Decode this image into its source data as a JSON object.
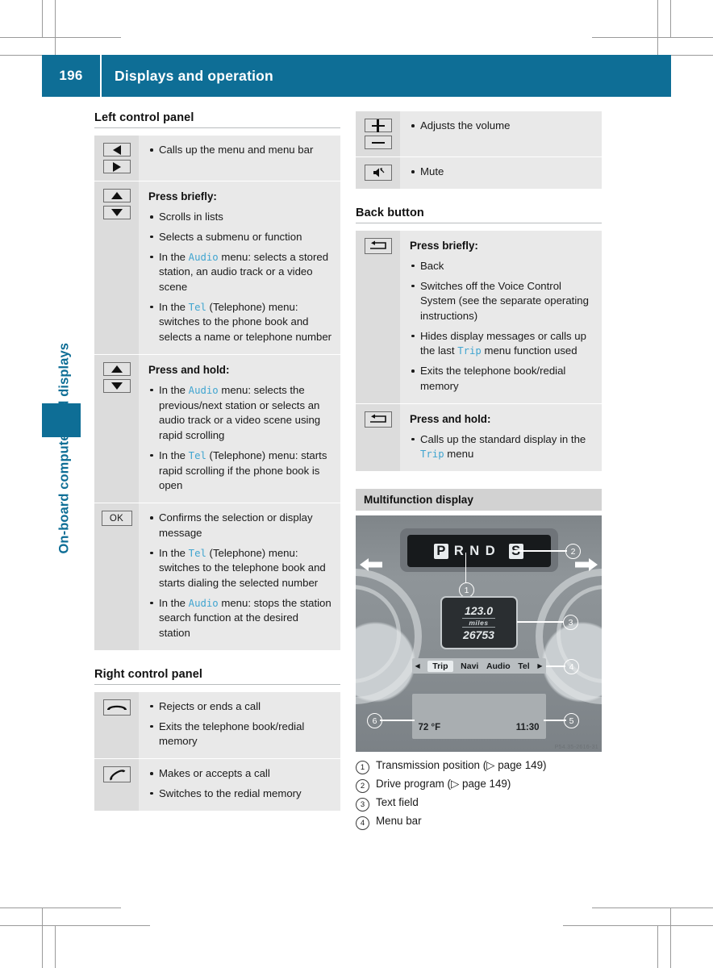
{
  "header": {
    "page_number": "196",
    "title": "Displays and operation",
    "accent_color": "#0e6e96"
  },
  "side_tab": {
    "label": "On-board computer and displays"
  },
  "left_column": {
    "section1_title": "Left control panel",
    "rows": [
      {
        "icons": [
          "triangle-left",
          "triangle-right"
        ],
        "heading": "",
        "bullets": [
          [
            {
              "t": "Calls up the menu and menu bar"
            }
          ]
        ]
      },
      {
        "icons": [
          "triangle-up",
          "triangle-down"
        ],
        "heading": "Press briefly:",
        "bullets": [
          [
            {
              "t": "Scrolls in lists"
            }
          ],
          [
            {
              "t": "Selects a submenu or function"
            }
          ],
          [
            {
              "t": "In the "
            },
            {
              "t": "Audio",
              "m": 1
            },
            {
              "t": " menu: selects a stored station, an audio track or a video scene"
            }
          ],
          [
            {
              "t": "In the "
            },
            {
              "t": "Tel",
              "m": 1
            },
            {
              "t": " (Telephone) menu: switches to the phone book and selects a name or telephone number"
            }
          ]
        ]
      },
      {
        "icons": [
          "triangle-up",
          "triangle-down"
        ],
        "heading": "Press and hold:",
        "bullets": [
          [
            {
              "t": "In the "
            },
            {
              "t": "Audio",
              "m": 1
            },
            {
              "t": " menu: selects the previous/next station or selects an audio track or a video scene using rapid scrolling"
            }
          ],
          [
            {
              "t": "In the "
            },
            {
              "t": "Tel",
              "m": 1
            },
            {
              "t": " (Telephone) menu: starts rapid scrolling if the phone book is open"
            }
          ]
        ]
      },
      {
        "icons": [
          "ok-key"
        ],
        "heading": "",
        "bullets": [
          [
            {
              "t": "Confirms the selection or display message"
            }
          ],
          [
            {
              "t": "In the "
            },
            {
              "t": "Tel",
              "m": 1
            },
            {
              "t": " (Telephone) menu: switches to the telephone book and starts dialing the selected number"
            }
          ],
          [
            {
              "t": "In the "
            },
            {
              "t": "Audio",
              "m": 1
            },
            {
              "t": " menu: stops the station search function at the desired station"
            }
          ]
        ]
      }
    ],
    "section2_title": "Right control panel",
    "rows2": [
      {
        "icons": [
          "phone-hangup"
        ],
        "heading": "",
        "bullets": [
          [
            {
              "t": "Rejects or ends a call"
            }
          ],
          [
            {
              "t": "Exits the telephone book/redial memory"
            }
          ]
        ]
      },
      {
        "icons": [
          "phone-pickup"
        ],
        "heading": "",
        "bullets": [
          [
            {
              "t": "Makes or accepts a call"
            }
          ],
          [
            {
              "t": "Switches to the redial memory"
            }
          ]
        ]
      }
    ]
  },
  "right_column": {
    "rows_top": [
      {
        "icons": [
          "plus-key",
          "minus-key"
        ],
        "heading": "",
        "bullets": [
          [
            {
              "t": "Adjusts the volume"
            }
          ]
        ]
      },
      {
        "icons": [
          "mute-key"
        ],
        "heading": "",
        "bullets": [
          [
            {
              "t": "Mute"
            }
          ]
        ]
      }
    ],
    "section_back_title": "Back button",
    "rows_back": [
      {
        "icons": [
          "back-key"
        ],
        "heading": "Press briefly:",
        "bullets": [
          [
            {
              "t": "Back"
            }
          ],
          [
            {
              "t": "Switches off the Voice Control System (see the separate operating instructions)"
            }
          ],
          [
            {
              "t": "Hides display messages or calls up the last "
            },
            {
              "t": "Trip",
              "m": 1
            },
            {
              "t": " menu function used"
            }
          ],
          [
            {
              "t": "Exits the telephone book/redial memory"
            }
          ]
        ]
      },
      {
        "icons": [
          "back-key"
        ],
        "heading": "Press and hold:",
        "bullets": [
          [
            {
              "t": "Calls up the standard display in the "
            },
            {
              "t": "Trip",
              "m": 1
            },
            {
              "t": " menu"
            }
          ]
        ]
      }
    ],
    "mfd_title": "Multifunction display",
    "cluster": {
      "gear_letters": [
        "P",
        "R",
        "N",
        "D",
        "S"
      ],
      "gear_boxed": [
        "P",
        "S"
      ],
      "text_field_top": "123.0",
      "text_field_unit": "miles",
      "text_field_bottom": "26753",
      "menu_items": [
        "Trip",
        "Navi",
        "Audio",
        "Tel"
      ],
      "menu_selected": "Trip",
      "menu_arrow_left": "◀",
      "menu_arrow_right": "▶",
      "temperature": "72 °F",
      "clock": "11:30",
      "watermark": "P54.35-2616-31",
      "callouts": [
        "1",
        "2",
        "3",
        "4",
        "5",
        "6"
      ]
    },
    "legend": [
      {
        "num": "1",
        "text": "Transmission position (▷ page 149)"
      },
      {
        "num": "2",
        "text": "Drive program (▷ page 149)"
      },
      {
        "num": "3",
        "text": "Text field"
      },
      {
        "num": "4",
        "text": "Menu bar"
      }
    ]
  }
}
